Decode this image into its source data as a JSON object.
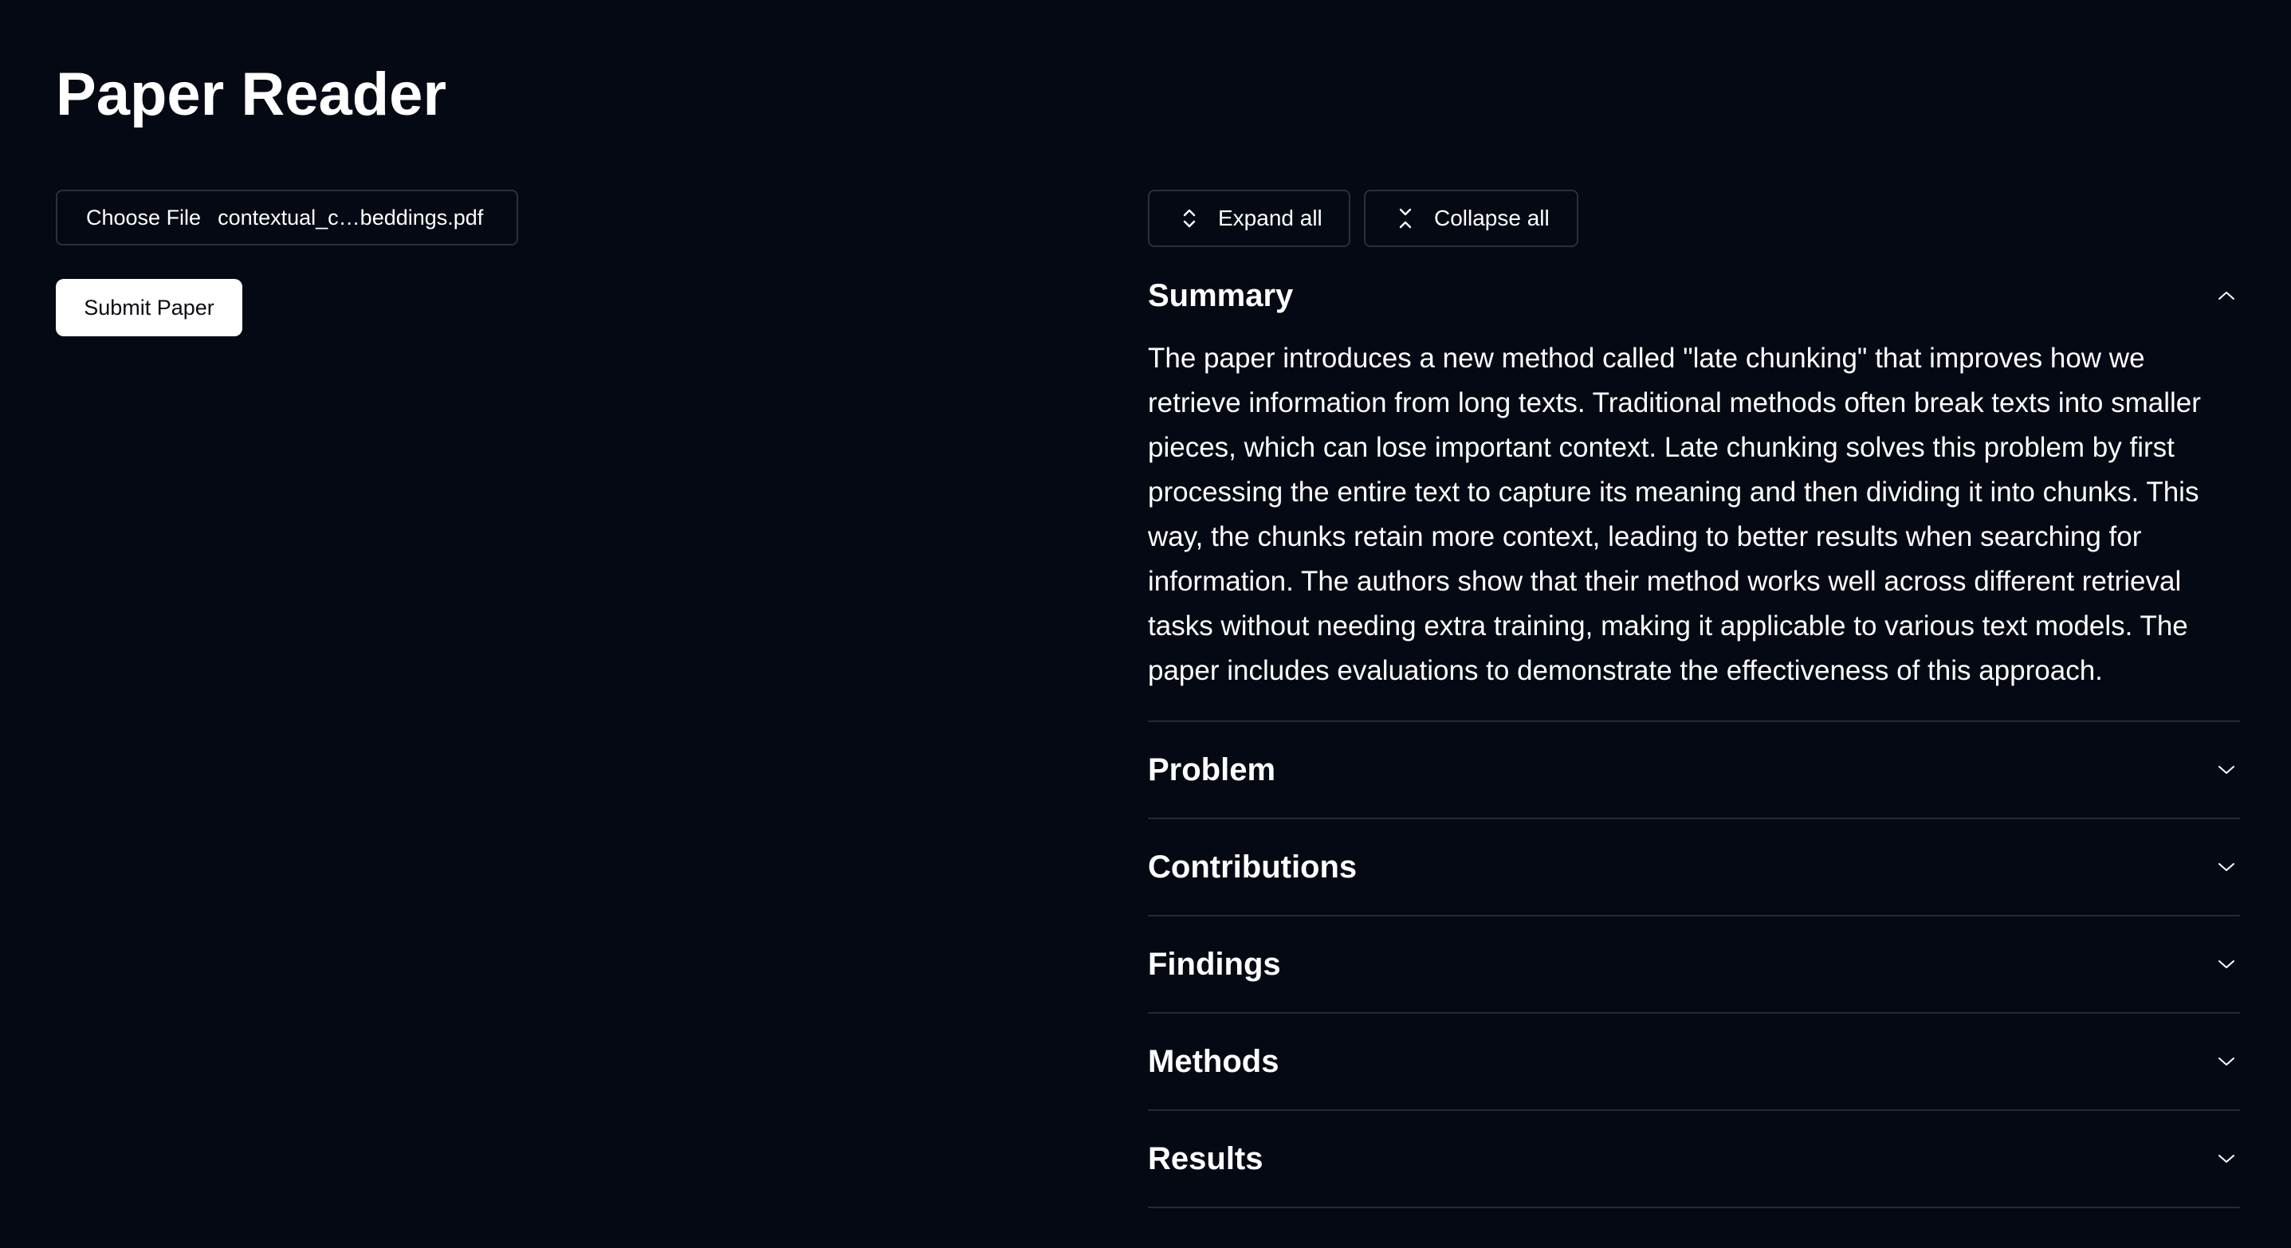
{
  "app": {
    "title": "Paper Reader"
  },
  "upload": {
    "choose_label": "Choose File",
    "file_name": "contextual_c…beddings.pdf",
    "submit_label": "Submit Paper"
  },
  "controls": {
    "expand_label": "Expand all",
    "collapse_label": "Collapse all"
  },
  "sections": {
    "summary": {
      "title": "Summary",
      "expanded": true,
      "body": "The paper introduces a new method called \"late chunking\" that improves how we retrieve information from long texts. Traditional methods often break texts into smaller pieces, which can lose important context. Late chunking solves this problem by first processing the entire text to capture its meaning and then dividing it into chunks. This way, the chunks retain more context, leading to better results when searching for information. The authors show that their method works well across different retrieval tasks without needing extra training, making it applicable to various text models. The paper includes evaluations to demonstrate the effectiveness of this approach."
    },
    "problem": {
      "title": "Problem",
      "expanded": false
    },
    "contributions": {
      "title": "Contributions",
      "expanded": false
    },
    "findings": {
      "title": "Findings",
      "expanded": false
    },
    "methods": {
      "title": "Methods",
      "expanded": false
    },
    "results": {
      "title": "Results",
      "expanded": false
    }
  },
  "icons": {
    "expand": "chevrons-up-down-icon",
    "collapse": "chevrons-down-up-icon",
    "section_open": "chevron-up-icon",
    "section_closed": "chevron-down-icon"
  },
  "colors": {
    "background": "#050913",
    "text": "#ffffff",
    "border": "#252a35",
    "button_light": "#ffffff"
  }
}
